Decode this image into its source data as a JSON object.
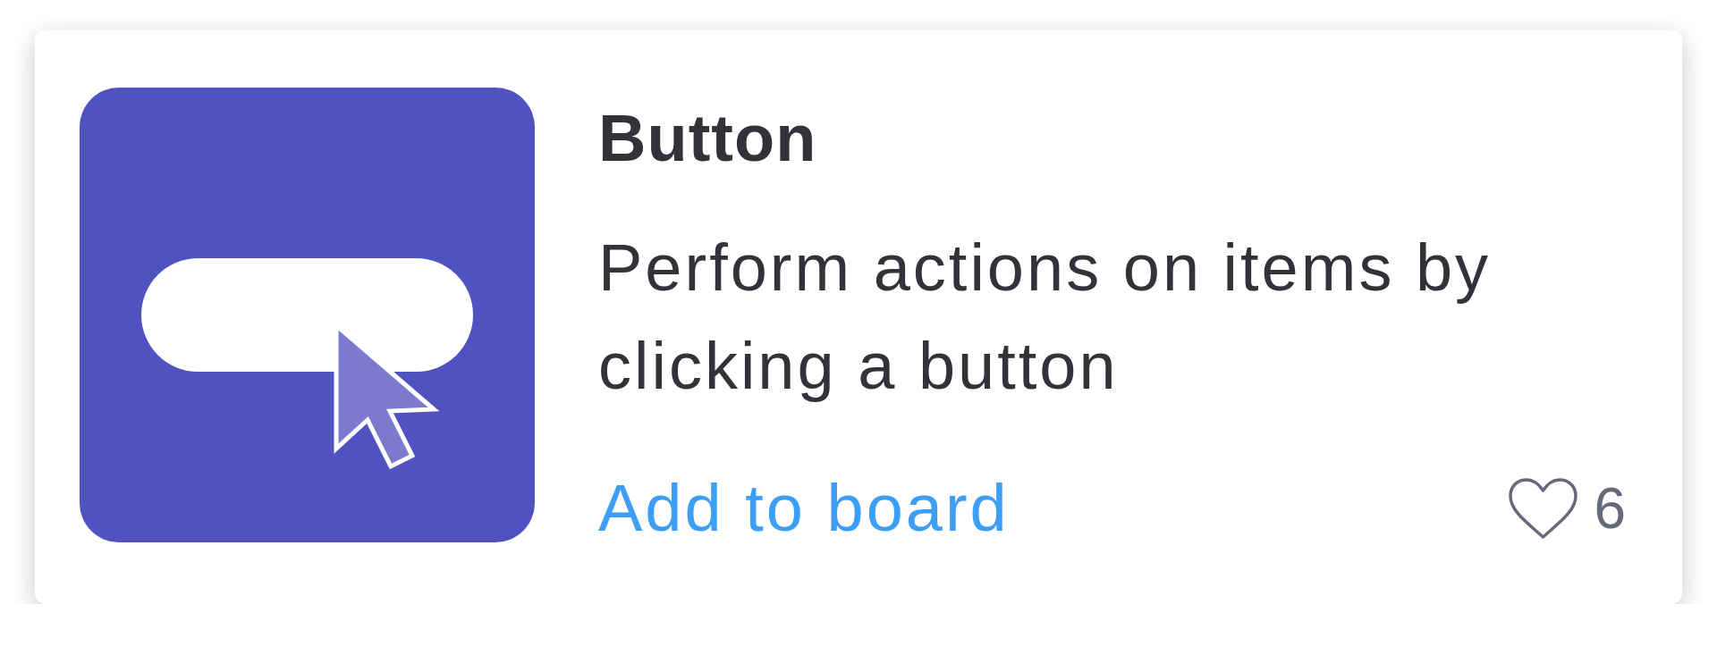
{
  "card": {
    "title": "Button",
    "description": "Perform actions on items by clicking a button",
    "action": "Add to board",
    "likes": "6"
  }
}
